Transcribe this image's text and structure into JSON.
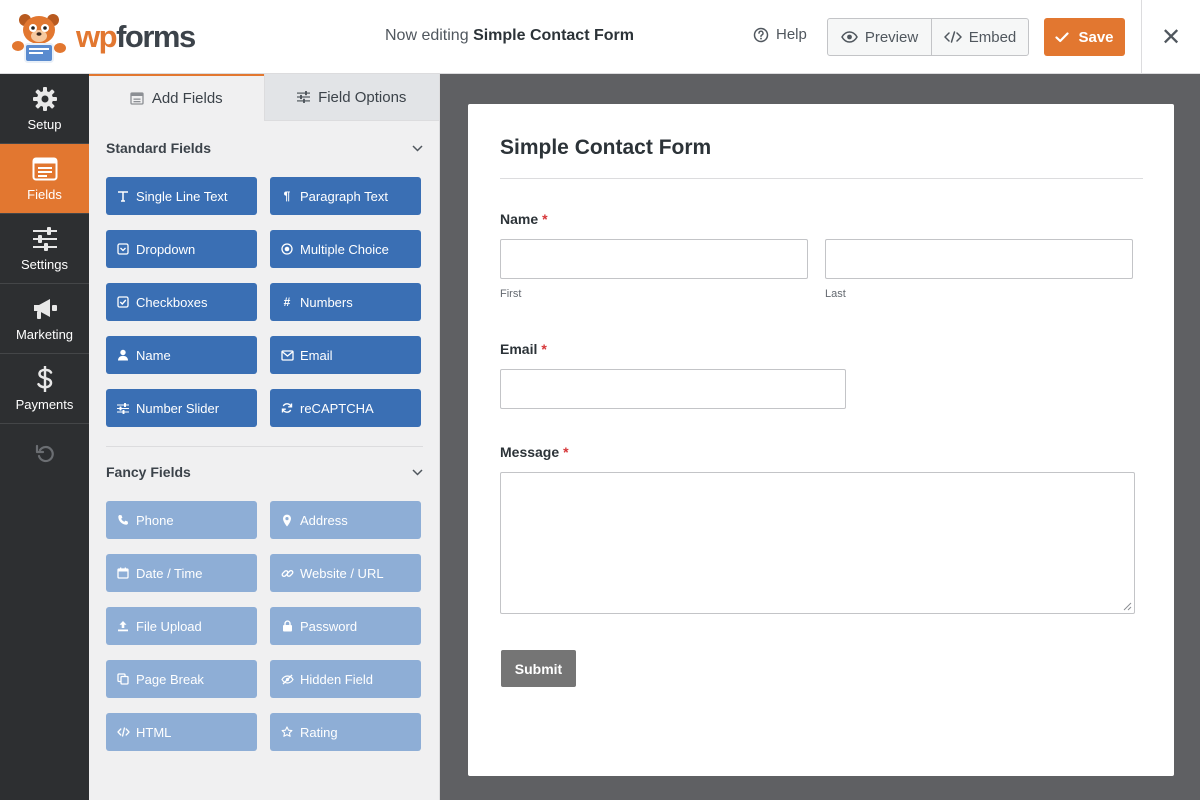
{
  "brand": {
    "wp": "wp",
    "forms": "forms"
  },
  "header": {
    "editing_prefix": "Now editing",
    "form_name": "Simple Contact Form",
    "help_label": "Help",
    "preview_label": "Preview",
    "embed_label": "Embed",
    "save_label": "Save",
    "close_glyph": "✕"
  },
  "nav": {
    "items": [
      {
        "label": "Setup",
        "icon": "gear-icon"
      },
      {
        "label": "Fields",
        "icon": "fields-icon",
        "active": true
      },
      {
        "label": "Settings",
        "icon": "sliders-icon"
      },
      {
        "label": "Marketing",
        "icon": "megaphone-icon"
      },
      {
        "label": "Payments",
        "icon": "dollar-icon"
      }
    ],
    "undo_icon": "undo-icon"
  },
  "panel": {
    "tabs": [
      {
        "label": "Add Fields",
        "icon": "list-icon",
        "active": true
      },
      {
        "label": "Field Options",
        "icon": "sliders-icon"
      }
    ],
    "standard_title": "Standard Fields",
    "standard_fields": [
      {
        "label": "Single Line Text",
        "icon": "text-icon"
      },
      {
        "label": "Paragraph Text",
        "icon": "paragraph-icon"
      },
      {
        "label": "Dropdown",
        "icon": "dropdown-icon"
      },
      {
        "label": "Multiple Choice",
        "icon": "radio-icon"
      },
      {
        "label": "Checkboxes",
        "icon": "checkbox-icon"
      },
      {
        "label": "Numbers",
        "icon": "hash-icon"
      },
      {
        "label": "Name",
        "icon": "user-icon"
      },
      {
        "label": "Email",
        "icon": "envelope-icon"
      },
      {
        "label": "Number Slider",
        "icon": "sliders-icon"
      },
      {
        "label": "reCAPTCHA",
        "icon": "refresh-icon"
      }
    ],
    "fancy_title": "Fancy Fields",
    "fancy_fields": [
      {
        "label": "Phone",
        "icon": "phone-icon"
      },
      {
        "label": "Address",
        "icon": "map-pin-icon"
      },
      {
        "label": "Date / Time",
        "icon": "calendar-icon"
      },
      {
        "label": "Website / URL",
        "icon": "link-icon"
      },
      {
        "label": "File Upload",
        "icon": "upload-icon"
      },
      {
        "label": "Password",
        "icon": "lock-icon"
      },
      {
        "label": "Page Break",
        "icon": "copy-icon"
      },
      {
        "label": "Hidden Field",
        "icon": "eye-slash-icon"
      },
      {
        "label": "HTML",
        "icon": "code-icon"
      },
      {
        "label": "Rating",
        "icon": "star-icon"
      }
    ]
  },
  "form": {
    "title": "Simple Contact Form",
    "name_label": "Name",
    "first_sublabel": "First",
    "last_sublabel": "Last",
    "email_label": "Email",
    "message_label": "Message",
    "required_mark": "*",
    "submit_label": "Submit"
  },
  "colors": {
    "accent": "#e27730",
    "standard_button": "#3a6fb4",
    "fancy_button": "#8eaed6",
    "nav_bg": "#2d2f31",
    "canvas_bg": "#5f6063",
    "required": "#d63638"
  }
}
